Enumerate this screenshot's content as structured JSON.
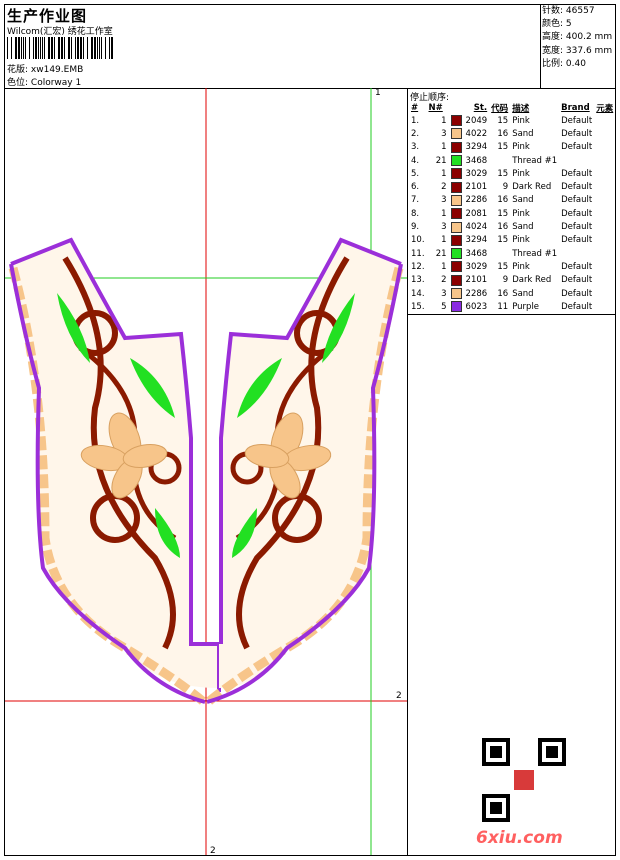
{
  "header": {
    "title": "生产作业图",
    "subtitle": "Wilcom(汇宏) 绣花工作室",
    "pattern_label": "花版:",
    "pattern_value": "xw149.EMB",
    "colorway_label": "色位:",
    "colorway_value": "Colorway 1"
  },
  "stats": [
    {
      "label": "针数:",
      "value": "46557"
    },
    {
      "label": "颜色:",
      "value": "5"
    },
    {
      "label": "高度:",
      "value": "400.2 mm"
    },
    {
      "label": "宽度:",
      "value": "337.6 mm"
    },
    {
      "label": "比例:",
      "value": "0.40"
    }
  ],
  "guides": {
    "top_right": "1",
    "mid_right": "2",
    "bottom": "2"
  },
  "thread_table": {
    "title": "停止顺序:",
    "headers": {
      "idx": "#",
      "n": "N#",
      "st": "St.",
      "code": "代码",
      "desc": "描述",
      "brand": "Brand",
      "elem": "元素"
    },
    "rows": [
      {
        "idx": "1.",
        "n": "1",
        "color": "#8b0000",
        "st": "2049",
        "code": "15",
        "desc": "Pink",
        "brand": "Default"
      },
      {
        "idx": "2.",
        "n": "3",
        "color": "#f7c58a",
        "st": "4022",
        "code": "16",
        "desc": "Sand",
        "brand": "Default"
      },
      {
        "idx": "3.",
        "n": "1",
        "color": "#8b0000",
        "st": "3294",
        "code": "15",
        "desc": "Pink",
        "brand": "Default"
      },
      {
        "idx": "4.",
        "n": "21",
        "color": "#22e022",
        "st": "3468",
        "code": "",
        "desc": "Thread #1",
        "brand": ""
      },
      {
        "idx": "5.",
        "n": "1",
        "color": "#8b0000",
        "st": "3029",
        "code": "15",
        "desc": "Pink",
        "brand": "Default"
      },
      {
        "idx": "6.",
        "n": "2",
        "color": "#8b0000",
        "st": "2101",
        "code": "9",
        "desc": "Dark Red",
        "brand": "Default"
      },
      {
        "idx": "7.",
        "n": "3",
        "color": "#f7c58a",
        "st": "2286",
        "code": "16",
        "desc": "Sand",
        "brand": "Default"
      },
      {
        "idx": "8.",
        "n": "1",
        "color": "#8b0000",
        "st": "2081",
        "code": "15",
        "desc": "Pink",
        "brand": "Default"
      },
      {
        "idx": "9.",
        "n": "3",
        "color": "#f7c58a",
        "st": "4024",
        "code": "16",
        "desc": "Sand",
        "brand": "Default"
      },
      {
        "idx": "10.",
        "n": "1",
        "color": "#8b0000",
        "st": "3294",
        "code": "15",
        "desc": "Pink",
        "brand": "Default"
      },
      {
        "idx": "11.",
        "n": "21",
        "color": "#22e022",
        "st": "3468",
        "code": "",
        "desc": "Thread #1",
        "brand": ""
      },
      {
        "idx": "12.",
        "n": "1",
        "color": "#8b0000",
        "st": "3029",
        "code": "15",
        "desc": "Pink",
        "brand": "Default"
      },
      {
        "idx": "13.",
        "n": "2",
        "color": "#8b0000",
        "st": "2101",
        "code": "9",
        "desc": "Dark Red",
        "brand": "Default"
      },
      {
        "idx": "14.",
        "n": "3",
        "color": "#f7c58a",
        "st": "2286",
        "code": "16",
        "desc": "Sand",
        "brand": "Default"
      },
      {
        "idx": "15.",
        "n": "5",
        "color": "#8a2be2",
        "st": "6023",
        "code": "11",
        "desc": "Purple",
        "brand": "Default"
      }
    ]
  },
  "colors": {
    "outline": "#9b2fd9",
    "sand": "#f7c58a",
    "maroon": "#8b1a00",
    "green": "#22e022",
    "guide_red": "#e00000",
    "guide_green": "#22cc22"
  },
  "watermark": "6xiu.com"
}
